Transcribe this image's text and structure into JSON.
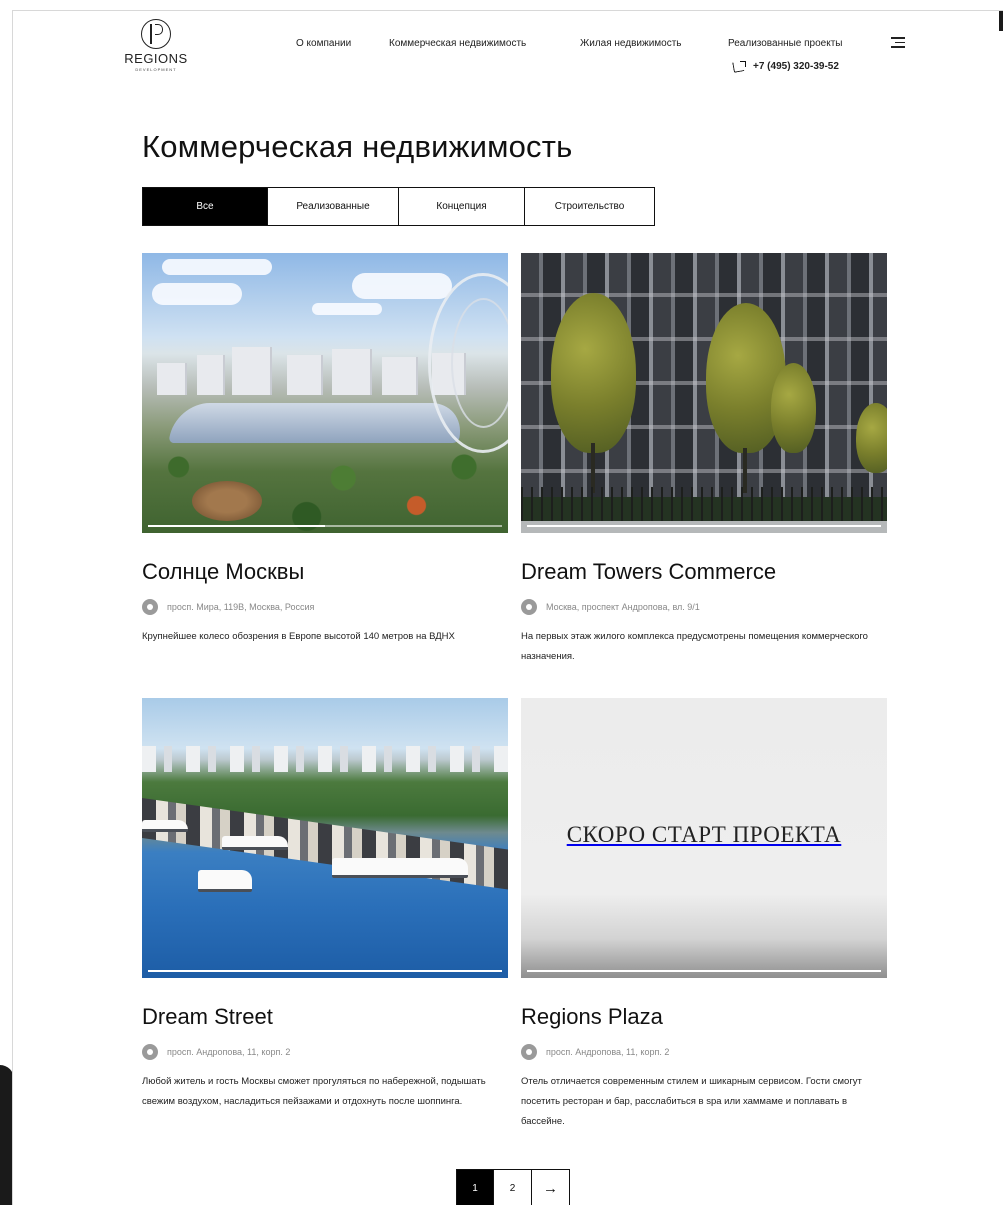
{
  "header": {
    "logo_name": "REGIONS",
    "logo_sub": "DEVELOPMENT",
    "nav": [
      {
        "label": "О компании"
      },
      {
        "label": "Коммерческая недвижимость"
      },
      {
        "label": "Жилая недвижимость"
      },
      {
        "label": "Реализованные проекты"
      }
    ],
    "phone": "+7 (495) 320-39-52"
  },
  "main": {
    "title": "Коммерческая недвижимость",
    "tabs": [
      {
        "label": "Все",
        "active": true
      },
      {
        "label": "Реализованные",
        "active": false
      },
      {
        "label": "Концепция",
        "active": false
      },
      {
        "label": "Строительство",
        "active": false
      }
    ],
    "cards": [
      {
        "title": "Солнце Москвы",
        "address": "просп. Мира, 119В, Москва, Россия",
        "description": "Крупнейшее колесо обозрения в Европе высотой 140 метров на ВДНХ",
        "slider_progress": 0.5
      },
      {
        "title": "Dream Towers Commerce",
        "address": "Москва, проспект Андропова, вл. 9/1",
        "description": "На первых этаж жилого комплекса предусмотрены помещения коммерческого назначения.",
        "slider_progress": 1
      },
      {
        "title": "Dream Street",
        "address": "просп. Андропова, 11, корп. 2",
        "description": "Любой житель и гость Москвы сможет прогуляться по набережной, подышать свежим воздухом, насладиться пейзажами и отдохнуть после шоппинга.",
        "slider_progress": 1
      },
      {
        "title": "Regions Plaza",
        "address": "просп. Андропова, 11, корп. 2",
        "description": "Отель отличается современным стилем и шикарным сервисом. Гости смогут посетить ресторан и бар, расслабиться в spa или хаммаме и поплавать в бассейне.",
        "image_text": "СКОРО СТАРТ ПРОЕКТА",
        "slider_progress": 1
      }
    ]
  },
  "pagination": {
    "pages": [
      "1",
      "2"
    ],
    "current": "1",
    "next_icon": "arrow-right-icon"
  },
  "colors": {
    "accent": "#000000",
    "text": "#111111",
    "muted": "#888888"
  }
}
